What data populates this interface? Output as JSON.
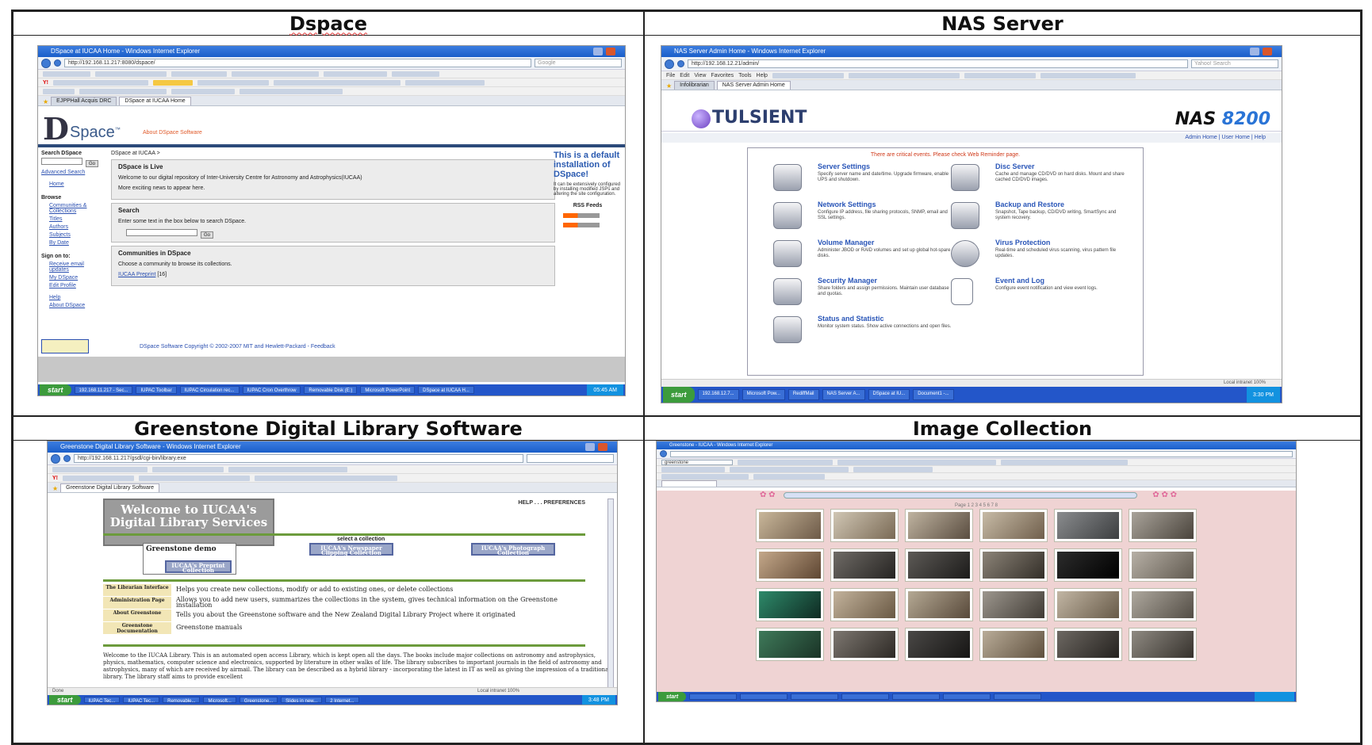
{
  "captions": {
    "dspace": "Dspace",
    "nas": "NAS Server",
    "greenstone": "Greenstone Digital Library Software",
    "images": "Image Collection"
  },
  "dspace": {
    "window_title": "DSpace at IUCAA Home - Windows Internet Explorer",
    "url": "http://192.168.11.217:8080/dspace/",
    "search_placeholder": "Google",
    "tabs": [
      "EJPPHall Acquis DRC",
      "DSpace at IUCAA Home"
    ],
    "logo_letter": "D",
    "logo_text": "Space",
    "logo_tm": "™",
    "about": "About DSpace Software",
    "breadcrumb": "DSpace at IUCAA >",
    "sidebar": {
      "search_heading": "Search DSpace",
      "go": "Go",
      "advanced": "Advanced Search",
      "home": "Home",
      "browse_heading": "Browse",
      "browse": [
        "Communities & Collections",
        "Titles",
        "Authors",
        "Subjects",
        "By Date"
      ],
      "sign_heading": "Sign on to:",
      "sign": [
        "Receive email updates",
        "My DSpace",
        "Edit Profile"
      ],
      "help": "Help",
      "about": "About DSpace"
    },
    "live_title": "DSpace is Live",
    "live_text": "Welcome to our digital repository of Inter-University Centre for Astronomy and Astrophysics(IUCAA)",
    "live_more": "More exciting news to appear here.",
    "search_title": "Search",
    "search_text": "Enter some text in the box below to search DSpace.",
    "search_go": "Go",
    "comm_title": "Communities in DSpace",
    "comm_text": "Choose a community to browse its collections.",
    "comm_link": "IUCAA Preprint",
    "comm_count": "[16]",
    "right_big": "This is a default installation of DSpace!",
    "right_small": "It can be extensively configured by installing modified JSPs and altering the site configuration.",
    "rss": "RSS Feeds",
    "footer": "DSpace Software Copyright © 2002-2007 MIT and Hewlett-Packard - Feedback",
    "taskbar": {
      "start": "start",
      "items": [
        "192.168.11.217 - Sec...",
        "IUPAC Toolbar",
        "IUPAC Circulation rec...",
        "IUPAC Cron Overthrow",
        "Removable Disk (E:)",
        "Microsoft PowerPoint",
        "DSpace at IUCAA H..."
      ],
      "clock": "05:45 AM"
    }
  },
  "nas": {
    "window_title": "NAS Server Admin Home - Windows Internet Explorer",
    "url": "http://192.168.12.21/admin/",
    "search_placeholder": "Yahoo! Search",
    "menu": [
      "File",
      "Edit",
      "View",
      "Favorites",
      "Tools",
      "Help"
    ],
    "tabs": [
      "Infolibrarian",
      "NAS Server Admin Home"
    ],
    "brand": "TULSIENT",
    "model_a": "NAS",
    "model_b": "8200",
    "links": "Admin Home  |  User Home  |  Help",
    "warning": "There are critical events. Please check Web Reminder page.",
    "items": [
      {
        "title": "Server Settings",
        "desc": "Specify server name and date/time. Upgrade firmware, enable UPS and shutdown."
      },
      {
        "title": "Disc Server",
        "desc": "Cache and manage CD/DVD on hard disks. Mount and share cached CD/DVD images."
      },
      {
        "title": "Network Settings",
        "desc": "Configure IP address, file sharing protocols, SNMP, email and SSL settings."
      },
      {
        "title": "Backup and Restore",
        "desc": "Snapshot, Tape backup, CD/DVD writing, SmartSync and system recovery."
      },
      {
        "title": "Volume Manager",
        "desc": "Administer JBOD or RAID volumes and set up global hot-spare disks."
      },
      {
        "title": "Virus Protection",
        "desc": "Real-time and scheduled virus scanning, virus pattern file updates."
      },
      {
        "title": "Security Manager",
        "desc": "Share folders and assign permissions. Maintain user database and quotas."
      },
      {
        "title": "Event and Log",
        "desc": "Configure event notification and view event logs."
      },
      {
        "title": "Status and Statistic",
        "desc": "Monitor system status. Show active connections and open files."
      }
    ],
    "status": "Local intranet",
    "zoom": "100%",
    "taskbar": {
      "start": "start",
      "items": [
        "192.168.12.7...",
        "Microsoft Pow...",
        "RediffMail",
        "NAS Server A...",
        "DSpace at IU...",
        "Document1 -..."
      ],
      "clock": "3:30 PM"
    }
  },
  "greenstone": {
    "window_title": "Greenstone Digital Library Software - Windows Internet Explorer",
    "url": "http://192.168.11.217/gsdl/cgi-bin/library.exe",
    "tabs": [
      "Greenstone Digital Library Software"
    ],
    "welcome": "Welcome to IUCAA's Digital Library Services",
    "help_prefs": "HELP . . . PREFERENCES",
    "select": "select a collection",
    "demo": "Greenstone demo",
    "collections": [
      "IUCAA's Newspaper Clipping Collection",
      "IUCAA's Photograph Collection",
      "IUCAA's Preprint Collection"
    ],
    "rows": [
      {
        "k": "The Librarian Interface",
        "v": "Helps you create new collections, modify or add to existing ones, or delete collections"
      },
      {
        "k": "Administration Page",
        "v": "Allows you to add new users, summarizes the collections in the system, gives technical information on the Greenstone installation"
      },
      {
        "k": "About Greenstone",
        "v": "Tells you about the Greenstone software and the New Zealand Digital Library Project where it originated"
      },
      {
        "k": "Greenstone Documentation",
        "v": "Greenstone manuals"
      }
    ],
    "body": "Welcome to the IUCAA Library. This is an automated open access Library, which is kept open all the days. The books include major collections on astronomy and astrophysics, physics, mathematics, computer science and electronics, supported by literature in other walks of life. The library subscribes to important journals in the field of astronomy and astrophysics, many of which are received by airmail. The library can be described as a hybrid library - incorporating the latest in IT as well as giving the impression of a traditional library. The library staff aims to provide excellent",
    "status": "Done",
    "zone": "Local intranet",
    "zoom": "100%",
    "taskbar": {
      "start": "start",
      "items": [
        "IUPAC Tec...",
        "IUPAC Tec...",
        "Removable...",
        "Microsoft...",
        "Greenstone...",
        "Slides in new...",
        "2 Internet..."
      ],
      "clock": "3:48 PM"
    }
  },
  "images": {
    "window_title": "Greenstone - IUCAA - Windows Internet Explorer",
    "search_value": "greenstone",
    "page_nav": "Page 1 2 3 4 5 6 7 8",
    "taskbar_start": "start"
  },
  "colors": {
    "xp_blue": "#2356c9",
    "start_green": "#3c9b3c",
    "dspace_navy": "#2c4a7a",
    "nas_link": "#2a56b8",
    "gallery_pink": "#efd3d3",
    "greenstone_rule": "#6c9b3c"
  },
  "icons": [
    "back-icon",
    "forward-icon",
    "star-icon",
    "home-icon",
    "window-close-icon",
    "folder-icon",
    "server-icon",
    "disc-icon",
    "shield-icon",
    "log-icon"
  ]
}
